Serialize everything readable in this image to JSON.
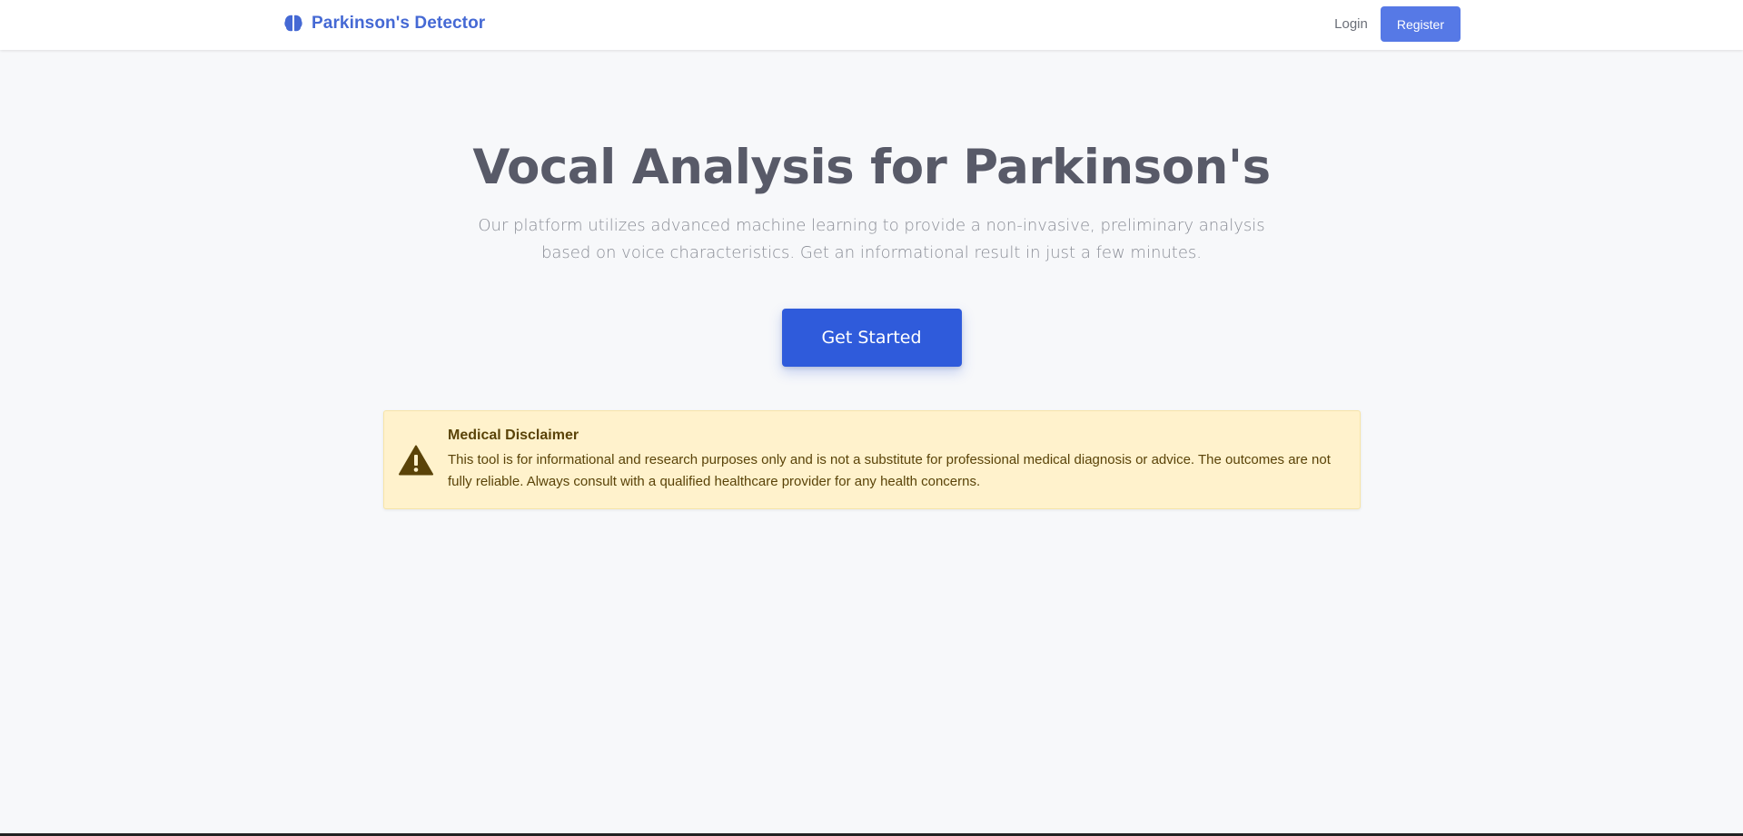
{
  "navbar": {
    "brand": "Parkinson's Detector",
    "brand_icon": "brain-icon",
    "login_label": "Login",
    "register_label": "Register"
  },
  "hero": {
    "title": "Vocal Analysis for Parkinson's",
    "subtitle": "Our platform utilizes advanced machine learning to provide a non-invasive, preliminary analysis based on voice characteristics. Get an informational result in just a few minutes.",
    "cta_label": "Get Started"
  },
  "disclaimer": {
    "icon": "warning-icon",
    "title": "Medical Disclaimer",
    "text": "This tool is for informational and research purposes only and is not a substitute for professional medical diagnosis or advice. The outcomes are not fully reliable. Always consult with a qualified healthcare provider for any health concerns."
  },
  "colors": {
    "brand": "#4569d4",
    "primary_button": "#2f5bdb",
    "register_button": "#5679e6",
    "disclaimer_bg": "#fff2cc",
    "disclaimer_text": "#5a4308"
  }
}
